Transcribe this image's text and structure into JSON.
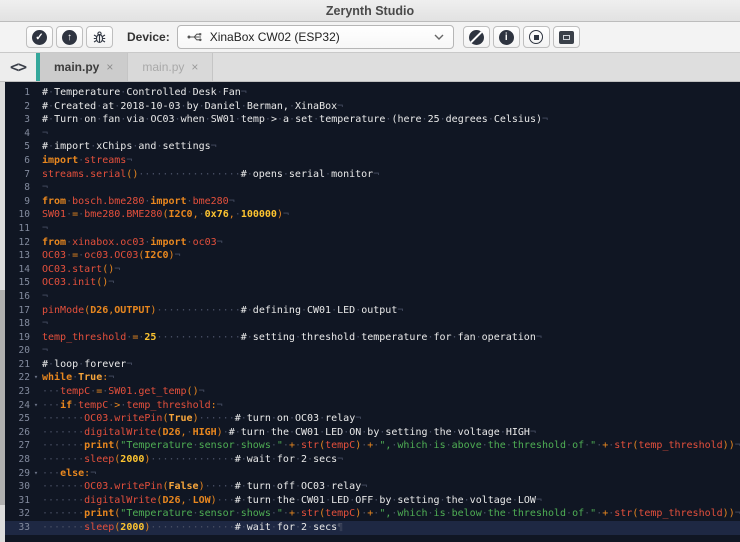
{
  "window": {
    "title": "Zerynth Studio"
  },
  "toolbar": {
    "device_label": "Device:",
    "device_value": "XinaBox CW02 (ESP32)",
    "icons": {
      "verify": "check-circle",
      "uplink": "arrow-up-circle",
      "debug": "bug",
      "help": "circle-diagonal-logo",
      "info": "info-circle",
      "stop": "stop-circle",
      "console": "console-square",
      "device": "usb-plug",
      "dropdown": "chevron-down"
    },
    "glyphs": {
      "check": "✓",
      "arrow_up": "↑",
      "info": "i"
    }
  },
  "tabbar": {
    "code_toggle_glyph": "<>",
    "close_glyph": "×",
    "accent_color": "#35a79b",
    "tabs": [
      {
        "label": "main.py",
        "active": true
      },
      {
        "label": "main.py",
        "active": false
      }
    ]
  },
  "editor": {
    "colors": {
      "background": "#101623",
      "active_line": "#1e2843",
      "plain": "#e9e9e9",
      "comment": "#e9e9e9",
      "keyword": "#e8871f",
      "identifier": "#e4503c",
      "number": "#fdc430",
      "boolean": "#f7a63c",
      "string": "#4fae54",
      "operator": "#e8871f",
      "whitespace": "#474e63",
      "line_number": "#838b9e",
      "fold_marker": "#6d7488"
    },
    "roles": {
      "c": "comment",
      "k": "keyword",
      "i": "identifier",
      "n": "number",
      "b": "boolean",
      "s": "string",
      "o": "operator",
      "": "plain"
    },
    "bold_roles": [
      "k",
      "b",
      "n"
    ],
    "eol_default": "¬",
    "fold_glyph": "▾",
    "lines": [
      {
        "n": 1,
        "t": [
          [
            "# Temperature Controlled Desk Fan",
            "c"
          ]
        ]
      },
      {
        "n": 2,
        "t": [
          [
            "# Created at 2018-10-03 by Daniel Berman, XinaBox",
            "c"
          ]
        ]
      },
      {
        "n": 3,
        "t": [
          [
            "# Turn on fan via OC03 when SW01 temp > a set temperature (here 25 degrees Celsius)",
            "c"
          ]
        ]
      },
      {
        "n": 4,
        "t": []
      },
      {
        "n": 5,
        "t": [
          [
            "# import xChips and settings",
            "c"
          ]
        ]
      },
      {
        "n": 6,
        "t": [
          [
            "import",
            "k"
          ],
          [
            " ",
            ""
          ],
          [
            "streams",
            "i"
          ]
        ]
      },
      {
        "n": 7,
        "t": [
          [
            "streams.serial",
            "i"
          ],
          [
            "()",
            "o"
          ],
          [
            "                 ",
            ""
          ],
          [
            "# opens serial monitor",
            "c"
          ]
        ]
      },
      {
        "n": 8,
        "t": []
      },
      {
        "n": 9,
        "t": [
          [
            "from",
            "k"
          ],
          [
            " ",
            ""
          ],
          [
            "bosch.bme280",
            "i"
          ],
          [
            " ",
            ""
          ],
          [
            "import",
            "k"
          ],
          [
            " ",
            ""
          ],
          [
            "bme280",
            "i"
          ]
        ]
      },
      {
        "n": 10,
        "t": [
          [
            "SW01",
            "i"
          ],
          [
            " ",
            ""
          ],
          [
            "=",
            "o"
          ],
          [
            " ",
            ""
          ],
          [
            "bme280.BME280",
            "i"
          ],
          [
            "(",
            "o"
          ],
          [
            "I2C0",
            "k"
          ],
          [
            ",",
            "o"
          ],
          [
            " ",
            ""
          ],
          [
            "0x76",
            "n"
          ],
          [
            ",",
            "o"
          ],
          [
            " ",
            ""
          ],
          [
            "100000",
            "n"
          ],
          [
            ")",
            "o"
          ]
        ]
      },
      {
        "n": 11,
        "t": []
      },
      {
        "n": 12,
        "t": [
          [
            "from",
            "k"
          ],
          [
            " ",
            ""
          ],
          [
            "xinabox.oc03",
            "i"
          ],
          [
            " ",
            ""
          ],
          [
            "import",
            "k"
          ],
          [
            " ",
            ""
          ],
          [
            "oc03",
            "i"
          ]
        ]
      },
      {
        "n": 13,
        "t": [
          [
            "OC03",
            "i"
          ],
          [
            " ",
            ""
          ],
          [
            "=",
            "o"
          ],
          [
            " ",
            ""
          ],
          [
            "oc03.OC03",
            "i"
          ],
          [
            "(",
            "o"
          ],
          [
            "I2C0",
            "k"
          ],
          [
            ")",
            "o"
          ]
        ]
      },
      {
        "n": 14,
        "t": [
          [
            "OC03.start",
            "i"
          ],
          [
            "()",
            "o"
          ]
        ]
      },
      {
        "n": 15,
        "t": [
          [
            "OC03.init",
            "i"
          ],
          [
            "()",
            "o"
          ]
        ]
      },
      {
        "n": 16,
        "t": []
      },
      {
        "n": 17,
        "t": [
          [
            "pinMode",
            "i"
          ],
          [
            "(",
            "o"
          ],
          [
            "D26",
            "k"
          ],
          [
            ",",
            "o"
          ],
          [
            "OUTPUT",
            "k"
          ],
          [
            ")",
            "o"
          ],
          [
            "              ",
            ""
          ],
          [
            "# defining CW01 LED output",
            "c"
          ]
        ]
      },
      {
        "n": 18,
        "t": []
      },
      {
        "n": 19,
        "t": [
          [
            "temp_threshold",
            "i"
          ],
          [
            " ",
            ""
          ],
          [
            "=",
            "o"
          ],
          [
            " ",
            ""
          ],
          [
            "25",
            "n"
          ],
          [
            "              ",
            ""
          ],
          [
            "# setting threshold temperature for fan operation",
            "c"
          ]
        ]
      },
      {
        "n": 20,
        "t": []
      },
      {
        "n": 21,
        "t": [
          [
            "# loop forever",
            "c"
          ]
        ]
      },
      {
        "n": 22,
        "f": true,
        "t": [
          [
            "while",
            "k"
          ],
          [
            " ",
            ""
          ],
          [
            "True",
            "b"
          ],
          [
            ":",
            "o"
          ]
        ]
      },
      {
        "n": 23,
        "t": [
          [
            "   ",
            ""
          ],
          [
            "tempC",
            "i"
          ],
          [
            " ",
            ""
          ],
          [
            "=",
            "o"
          ],
          [
            " ",
            ""
          ],
          [
            "SW01.get_temp",
            "i"
          ],
          [
            "()",
            "o"
          ]
        ]
      },
      {
        "n": 24,
        "f": true,
        "t": [
          [
            "   ",
            ""
          ],
          [
            "if",
            "k"
          ],
          [
            " ",
            ""
          ],
          [
            "tempC",
            "i"
          ],
          [
            " ",
            ""
          ],
          [
            ">",
            "o"
          ],
          [
            " ",
            ""
          ],
          [
            "temp_threshold",
            "i"
          ],
          [
            ":",
            "o"
          ]
        ]
      },
      {
        "n": 25,
        "t": [
          [
            "       ",
            ""
          ],
          [
            "OC03.writePin",
            "i"
          ],
          [
            "(",
            "o"
          ],
          [
            "True",
            "b"
          ],
          [
            ")",
            "o"
          ],
          [
            "      ",
            ""
          ],
          [
            "# turn on OC03 relay",
            "c"
          ]
        ]
      },
      {
        "n": 26,
        "t": [
          [
            "       ",
            ""
          ],
          [
            "digitalWrite",
            "i"
          ],
          [
            "(",
            "o"
          ],
          [
            "D26",
            "k"
          ],
          [
            ",",
            "o"
          ],
          [
            " ",
            ""
          ],
          [
            "HIGH",
            "k"
          ],
          [
            ")",
            "o"
          ],
          [
            " ",
            ""
          ],
          [
            "# turn the CW01 LED ON by setting the voltage HIGH",
            "c"
          ]
        ]
      },
      {
        "n": 27,
        "t": [
          [
            "       ",
            ""
          ],
          [
            "print",
            "k"
          ],
          [
            "(",
            "o"
          ],
          [
            "\"Temperature sensor shows \"",
            "s"
          ],
          [
            " ",
            ""
          ],
          [
            "+",
            "o"
          ],
          [
            " ",
            ""
          ],
          [
            "str",
            "i"
          ],
          [
            "(",
            "o"
          ],
          [
            "tempC",
            "i"
          ],
          [
            ")",
            "o"
          ],
          [
            " ",
            ""
          ],
          [
            "+",
            "o"
          ],
          [
            " ",
            ""
          ],
          [
            "\", which is above the threshold of \"",
            "s"
          ],
          [
            " ",
            ""
          ],
          [
            "+",
            "o"
          ],
          [
            " ",
            ""
          ],
          [
            "str",
            "i"
          ],
          [
            "(",
            "o"
          ],
          [
            "temp_threshold",
            "i"
          ],
          [
            "))",
            "o"
          ]
        ]
      },
      {
        "n": 28,
        "t": [
          [
            "       ",
            ""
          ],
          [
            "sleep",
            "i"
          ],
          [
            "(",
            "o"
          ],
          [
            "2000",
            "n"
          ],
          [
            ")",
            "o"
          ],
          [
            "              ",
            ""
          ],
          [
            "# wait for 2 secs",
            "c"
          ]
        ]
      },
      {
        "n": 29,
        "f": true,
        "t": [
          [
            "   ",
            ""
          ],
          [
            "else",
            "k"
          ],
          [
            ":",
            "o"
          ]
        ]
      },
      {
        "n": 30,
        "t": [
          [
            "       ",
            ""
          ],
          [
            "OC03.writePin",
            "i"
          ],
          [
            "(",
            "o"
          ],
          [
            "False",
            "b"
          ],
          [
            ")",
            "o"
          ],
          [
            "     ",
            ""
          ],
          [
            "# turn off OC03 relay",
            "c"
          ]
        ]
      },
      {
        "n": 31,
        "t": [
          [
            "       ",
            ""
          ],
          [
            "digitalWrite",
            "i"
          ],
          [
            "(",
            "o"
          ],
          [
            "D26",
            "k"
          ],
          [
            ",",
            "o"
          ],
          [
            " ",
            ""
          ],
          [
            "LOW",
            "k"
          ],
          [
            ")",
            "o"
          ],
          [
            "   ",
            ""
          ],
          [
            "# turn the CW01 LED OFF by setting the voltage LOW",
            "c"
          ]
        ]
      },
      {
        "n": 32,
        "t": [
          [
            "       ",
            ""
          ],
          [
            "print",
            "k"
          ],
          [
            "(",
            "o"
          ],
          [
            "\"Temperature sensor shows \"",
            "s"
          ],
          [
            " ",
            ""
          ],
          [
            "+",
            "o"
          ],
          [
            " ",
            ""
          ],
          [
            "str",
            "i"
          ],
          [
            "(",
            "o"
          ],
          [
            "tempC",
            "i"
          ],
          [
            ")",
            "o"
          ],
          [
            " ",
            ""
          ],
          [
            "+",
            "o"
          ],
          [
            " ",
            ""
          ],
          [
            "\", which is below the threshold of \"",
            "s"
          ],
          [
            " ",
            ""
          ],
          [
            "+",
            "o"
          ],
          [
            " ",
            ""
          ],
          [
            "str",
            "i"
          ],
          [
            "(",
            "o"
          ],
          [
            "temp_threshold",
            "i"
          ],
          [
            "))",
            "o"
          ]
        ]
      },
      {
        "n": 33,
        "h": true,
        "e": "¶",
        "t": [
          [
            "       ",
            ""
          ],
          [
            "sleep",
            "i"
          ],
          [
            "(",
            "o"
          ],
          [
            "2000",
            "n"
          ],
          [
            ")",
            "o"
          ],
          [
            "              ",
            ""
          ],
          [
            "# wait for 2 secs",
            "c"
          ]
        ]
      }
    ]
  }
}
